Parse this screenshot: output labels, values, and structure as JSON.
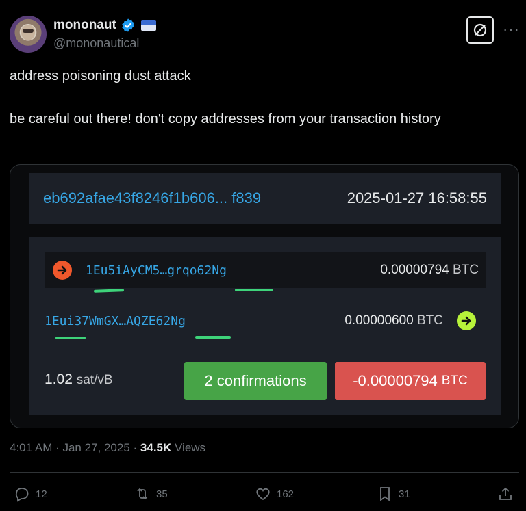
{
  "author": {
    "display_name": "mononaut",
    "handle": "@mononautical",
    "avatar_icon": "astronaut-avatar",
    "badge_icon": "verified-badge-icon"
  },
  "tweet": {
    "lines": [
      "address poisoning dust attack",
      "be careful out there! don't copy addresses from your transaction history"
    ]
  },
  "transaction": {
    "hash": "eb692afae43f8246f1b606... f839",
    "timestamp": "2025-01-27 16:58:55",
    "input": {
      "address": "1Eu5iAyCM5…grqo62Ng",
      "amount": "0.00000794",
      "unit": "BTC"
    },
    "output": {
      "address": "1Eui37WmGX…AQZE62Ng",
      "amount": "0.00000600",
      "unit": "BTC"
    },
    "fee_rate": "1.02",
    "fee_unit": "sat/vB",
    "confirmations": "2 confirmations",
    "net_amount": "-0.00000794",
    "net_unit": "BTC",
    "colors": {
      "input_arrow": "#f0582c",
      "output_arrow": "#b7f23a",
      "highlight_underline": "#3ed37a",
      "confirm_badge": "#47a447",
      "net_badge": "#d9534f"
    }
  },
  "meta": {
    "time": "4:01 AM · Jan 27, 2025 · ",
    "views_count": "34.5K",
    "views_label": " Views"
  },
  "actions": {
    "replies": "12",
    "reposts": "35",
    "likes": "162",
    "bookmarks": "31"
  }
}
